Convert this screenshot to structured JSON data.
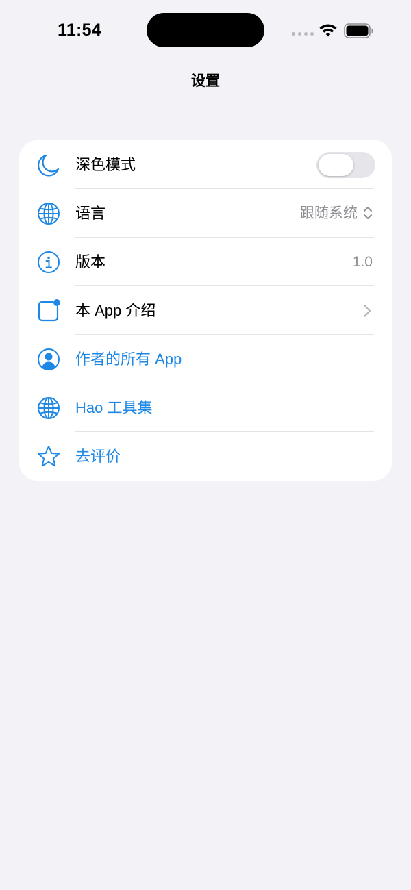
{
  "status_bar": {
    "time": "11:54",
    "icons": [
      "cellular-signal-icon",
      "wifi-icon",
      "battery-icon"
    ]
  },
  "nav": {
    "title": "设置"
  },
  "colors": {
    "accent": "#1f88e5",
    "background": "#f2f2f7",
    "card": "#ffffff",
    "secondary_text": "#8e8e93",
    "toggle_off": "#e5e5ea"
  },
  "settings": {
    "dark_mode": {
      "label": "深色模式",
      "icon": "moon-icon",
      "enabled": false
    },
    "language": {
      "label": "语言",
      "icon": "globe-icon",
      "value": "跟随系统"
    },
    "version": {
      "label": "版本",
      "icon": "info-icon",
      "value": "1.0"
    },
    "app_intro": {
      "label": "本 App 介绍",
      "icon": "app-badge-icon"
    },
    "author_apps": {
      "label": "作者的所有 App",
      "icon": "person-circle-icon"
    },
    "hao_tools": {
      "label": "Hao 工具集",
      "icon": "globe-icon"
    },
    "rate": {
      "label": "去评价",
      "icon": "star-icon"
    }
  }
}
